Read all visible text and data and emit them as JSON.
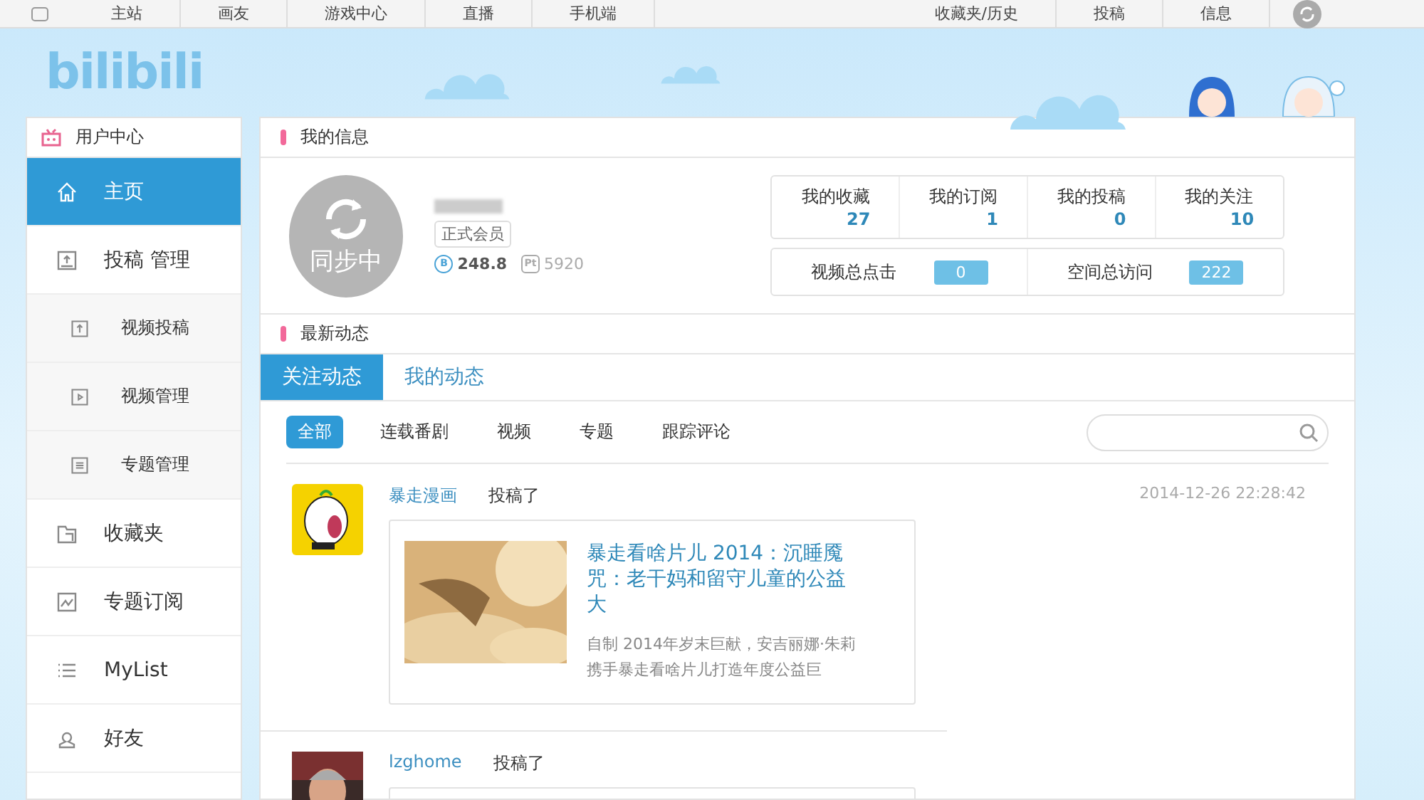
{
  "top_nav": {
    "left": [
      "主站",
      "画友",
      "游戏中心",
      "直播",
      "手机端"
    ],
    "right": [
      "收藏夹/历史",
      "投稿",
      "信息"
    ]
  },
  "logo": "bilibili",
  "sidebar": {
    "title": "用户中心",
    "items": [
      {
        "label": "主页",
        "kind": "main",
        "selected": true
      },
      {
        "label": "投稿 管理",
        "kind": "main",
        "selected": false
      },
      {
        "label": "视频投稿",
        "kind": "sub",
        "selected": false
      },
      {
        "label": "视频管理",
        "kind": "sub",
        "selected": false
      },
      {
        "label": "专题管理",
        "kind": "sub",
        "selected": false
      },
      {
        "label": "收藏夹",
        "kind": "main",
        "selected": false
      },
      {
        "label": "专题订阅",
        "kind": "main",
        "selected": false
      },
      {
        "label": "MyList",
        "kind": "main",
        "selected": false
      },
      {
        "label": "好友",
        "kind": "main",
        "selected": false
      }
    ]
  },
  "info": {
    "title": "我的信息",
    "avatar_text": "同步中",
    "badge": "正式会员",
    "coins": {
      "symbol": "B",
      "value": "248.8"
    },
    "points": {
      "symbol": "Pt",
      "value": "5920"
    },
    "stats": [
      {
        "label": "我的收藏",
        "value": "27"
      },
      {
        "label": "我的订阅",
        "value": "1"
      },
      {
        "label": "我的投稿",
        "value": "0"
      },
      {
        "label": "我的关注",
        "value": "10"
      }
    ],
    "totals": [
      {
        "label": "视频总点击",
        "value": "0"
      },
      {
        "label": "空间总访问",
        "value": "222"
      }
    ]
  },
  "feed": {
    "title": "最新动态",
    "tabs": [
      {
        "label": "关注动态",
        "selected": true
      },
      {
        "label": "我的动态",
        "selected": false
      }
    ],
    "filters": [
      {
        "label": "全部",
        "selected": true
      },
      {
        "label": "连载番剧",
        "selected": false
      },
      {
        "label": "视频",
        "selected": false
      },
      {
        "label": "专题",
        "selected": false
      },
      {
        "label": "跟踪评论",
        "selected": false
      }
    ],
    "items": [
      {
        "user": "暴走漫画",
        "action": "投稿了",
        "time": "2014-12-26 22:28:42",
        "card": {
          "title": "暴走看啥片儿 2014：沉睡魇咒：老干妈和留守儿童的公益大",
          "description": "自制 2014年岁末巨献，安吉丽娜·朱莉携手暴走看啥片儿打造年度公益巨"
        }
      },
      {
        "user": "lzghome",
        "action": "投稿了"
      }
    ]
  }
}
